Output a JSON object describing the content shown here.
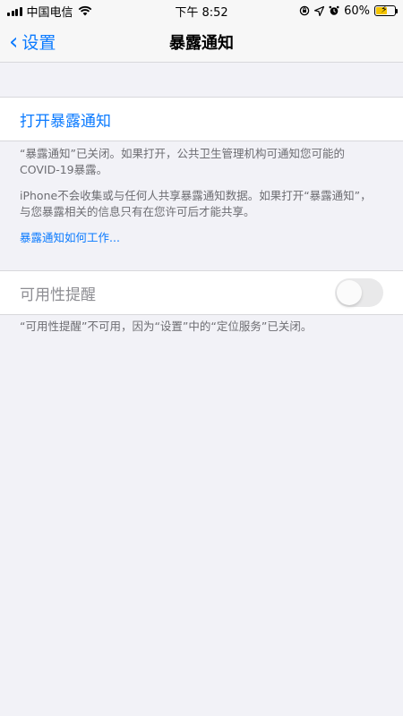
{
  "status_bar": {
    "carrier": "中国电信",
    "time": "下午 8:52",
    "battery_percent": "60%",
    "battery_level": 0.6,
    "battery_color": "#f4c400"
  },
  "nav": {
    "back_label": "设置",
    "title": "暴露通知"
  },
  "section1": {
    "action_label": "打开暴露通知",
    "footer_line1": "“暴露通知”已关闭。如果打开，公共卫生管理机构可通知您可能的COVID-19暴露。",
    "footer_line2": "iPhone不会收集或与任何人共享暴露通知数据。如果打开“暴露通知”，与您暴露相关的信息只有在您许可后才能共享。",
    "footer_link": "暴露通知如何工作..."
  },
  "section2": {
    "label": "可用性提醒",
    "toggle_on": false,
    "footer": "“可用性提醒”不可用，因为“设置”中的“定位服务”已关闭。"
  },
  "icons": [
    "signal-icon",
    "wifi-icon",
    "screen-rotation-lock-icon",
    "location-arrow-icon",
    "alarm-icon",
    "battery-icon",
    "back-chevron-icon"
  ],
  "colors": {
    "accent": "#0a7aff",
    "background": "#f2f2f7"
  }
}
